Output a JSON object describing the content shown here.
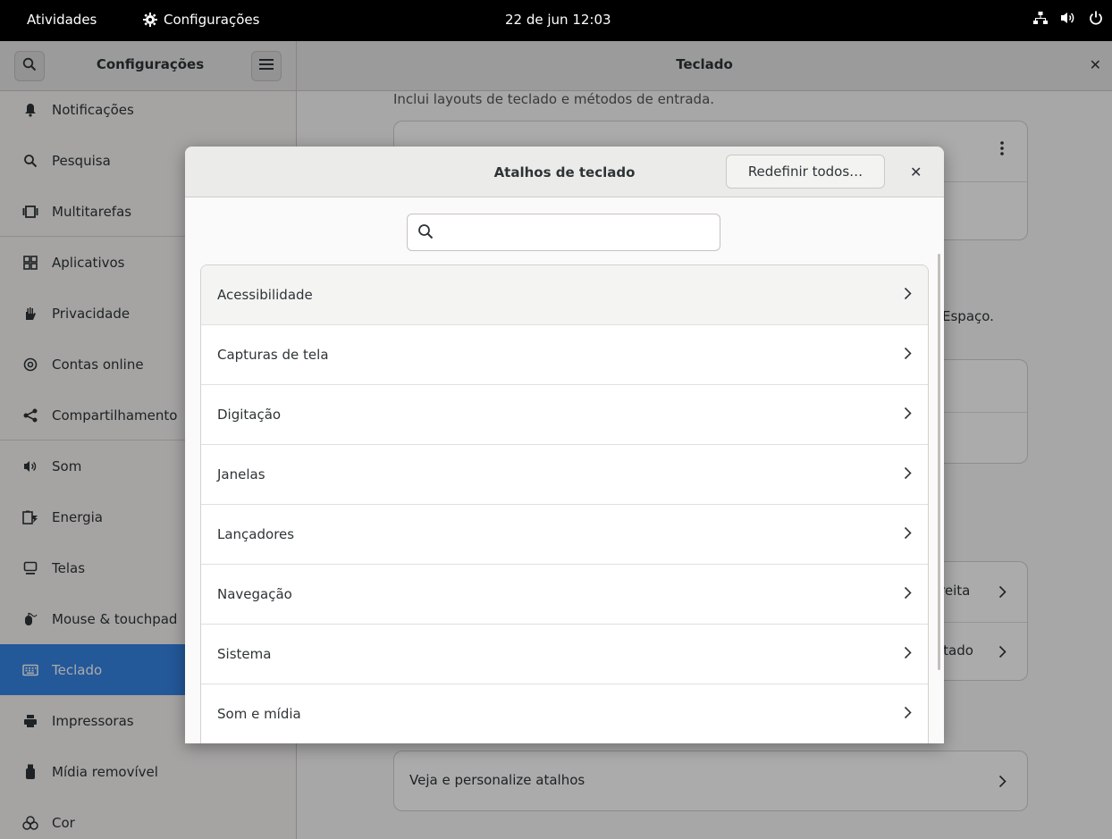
{
  "topbar": {
    "activities": "Atividades",
    "app_name": "Configurações",
    "clock": "22 de jun  12:03"
  },
  "window": {
    "sidebar_title": "Configurações",
    "main_title": "Teclado"
  },
  "sidebar": {
    "items": [
      {
        "label": "Notificações",
        "icon": "bell-icon"
      },
      {
        "label": "Pesquisa",
        "icon": "search-icon"
      },
      {
        "label": "Multitarefas",
        "icon": "multitasking-icon"
      },
      {
        "label": "Aplicativos",
        "icon": "apps-grid-icon"
      },
      {
        "label": "Privacidade",
        "icon": "hand-icon"
      },
      {
        "label": "Contas online",
        "icon": "at-icon"
      },
      {
        "label": "Compartilhamento",
        "icon": "share-icon"
      },
      {
        "label": "Som",
        "icon": "speaker-icon"
      },
      {
        "label": "Energia",
        "icon": "battery-icon"
      },
      {
        "label": "Telas",
        "icon": "monitor-icon"
      },
      {
        "label": "Mouse & touchpad",
        "icon": "mouse-icon"
      },
      {
        "label": "Teclado",
        "icon": "keyboard-icon",
        "active": true
      },
      {
        "label": "Impressoras",
        "icon": "printer-icon"
      },
      {
        "label": "Mídia removível",
        "icon": "usb-icon"
      },
      {
        "label": "Cor",
        "icon": "color-icon"
      }
    ]
  },
  "main": {
    "description": "Inclui layouts de teclado e métodos de entrada.",
    "frag_espaco": "Espaço.",
    "frag_direita": "reita",
    "frag_digitado": "itado",
    "shortcuts_row": "Veja e personalize atalhos"
  },
  "dialog": {
    "title": "Atalhos de teclado",
    "reset_button": "Redefinir todos…",
    "search_value": "",
    "categories": [
      "Acessibilidade",
      "Capturas de tela",
      "Digitação",
      "Janelas",
      "Lançadores",
      "Navegação",
      "Sistema",
      "Som e mídia"
    ]
  },
  "colors": {
    "accent": "#3584e4",
    "topbar": "#000000"
  }
}
